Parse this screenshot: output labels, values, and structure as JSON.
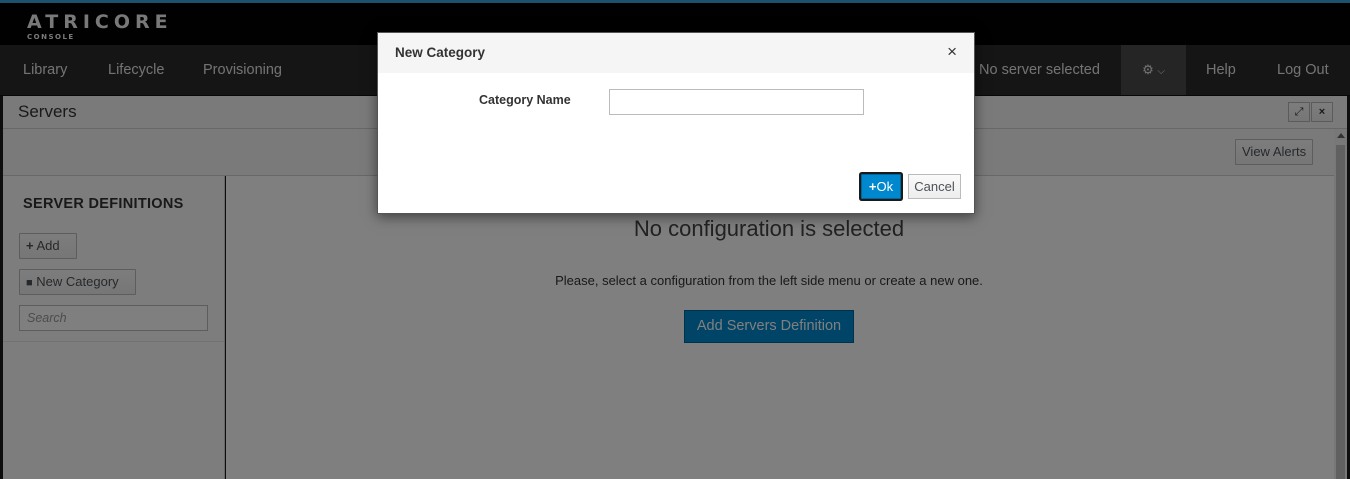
{
  "app": {
    "logo_main": "ATRICORE",
    "logo_sub": "CONSOLE"
  },
  "nav": {
    "items": [
      {
        "label": "Library"
      },
      {
        "label": "Lifecycle"
      },
      {
        "label": "Provisioning"
      }
    ],
    "server_status": "No server selected",
    "settings_icon": "gear-icon",
    "help": "Help",
    "logout": "Log Out"
  },
  "panel": {
    "title": "Servers",
    "view_alerts": "View Alerts"
  },
  "sidebar": {
    "heading": "SERVER DEFINITIONS",
    "add_label": "Add",
    "new_category_label": "New Category",
    "search_placeholder": "Search"
  },
  "main": {
    "empty_title": "No configuration is selected",
    "empty_text": "Please, select a configuration from the left side menu or create a new one.",
    "add_definition_label": "Add Servers Definition"
  },
  "modal": {
    "title": "New Category",
    "field_label": "Category Name",
    "field_value": "",
    "ok_label": "Ok",
    "cancel_label": "Cancel"
  },
  "colors": {
    "accent": "#0088ce",
    "topline": "#39a5dc",
    "header_bg": "#030303",
    "navbar_bg": "#2b2b2b"
  }
}
